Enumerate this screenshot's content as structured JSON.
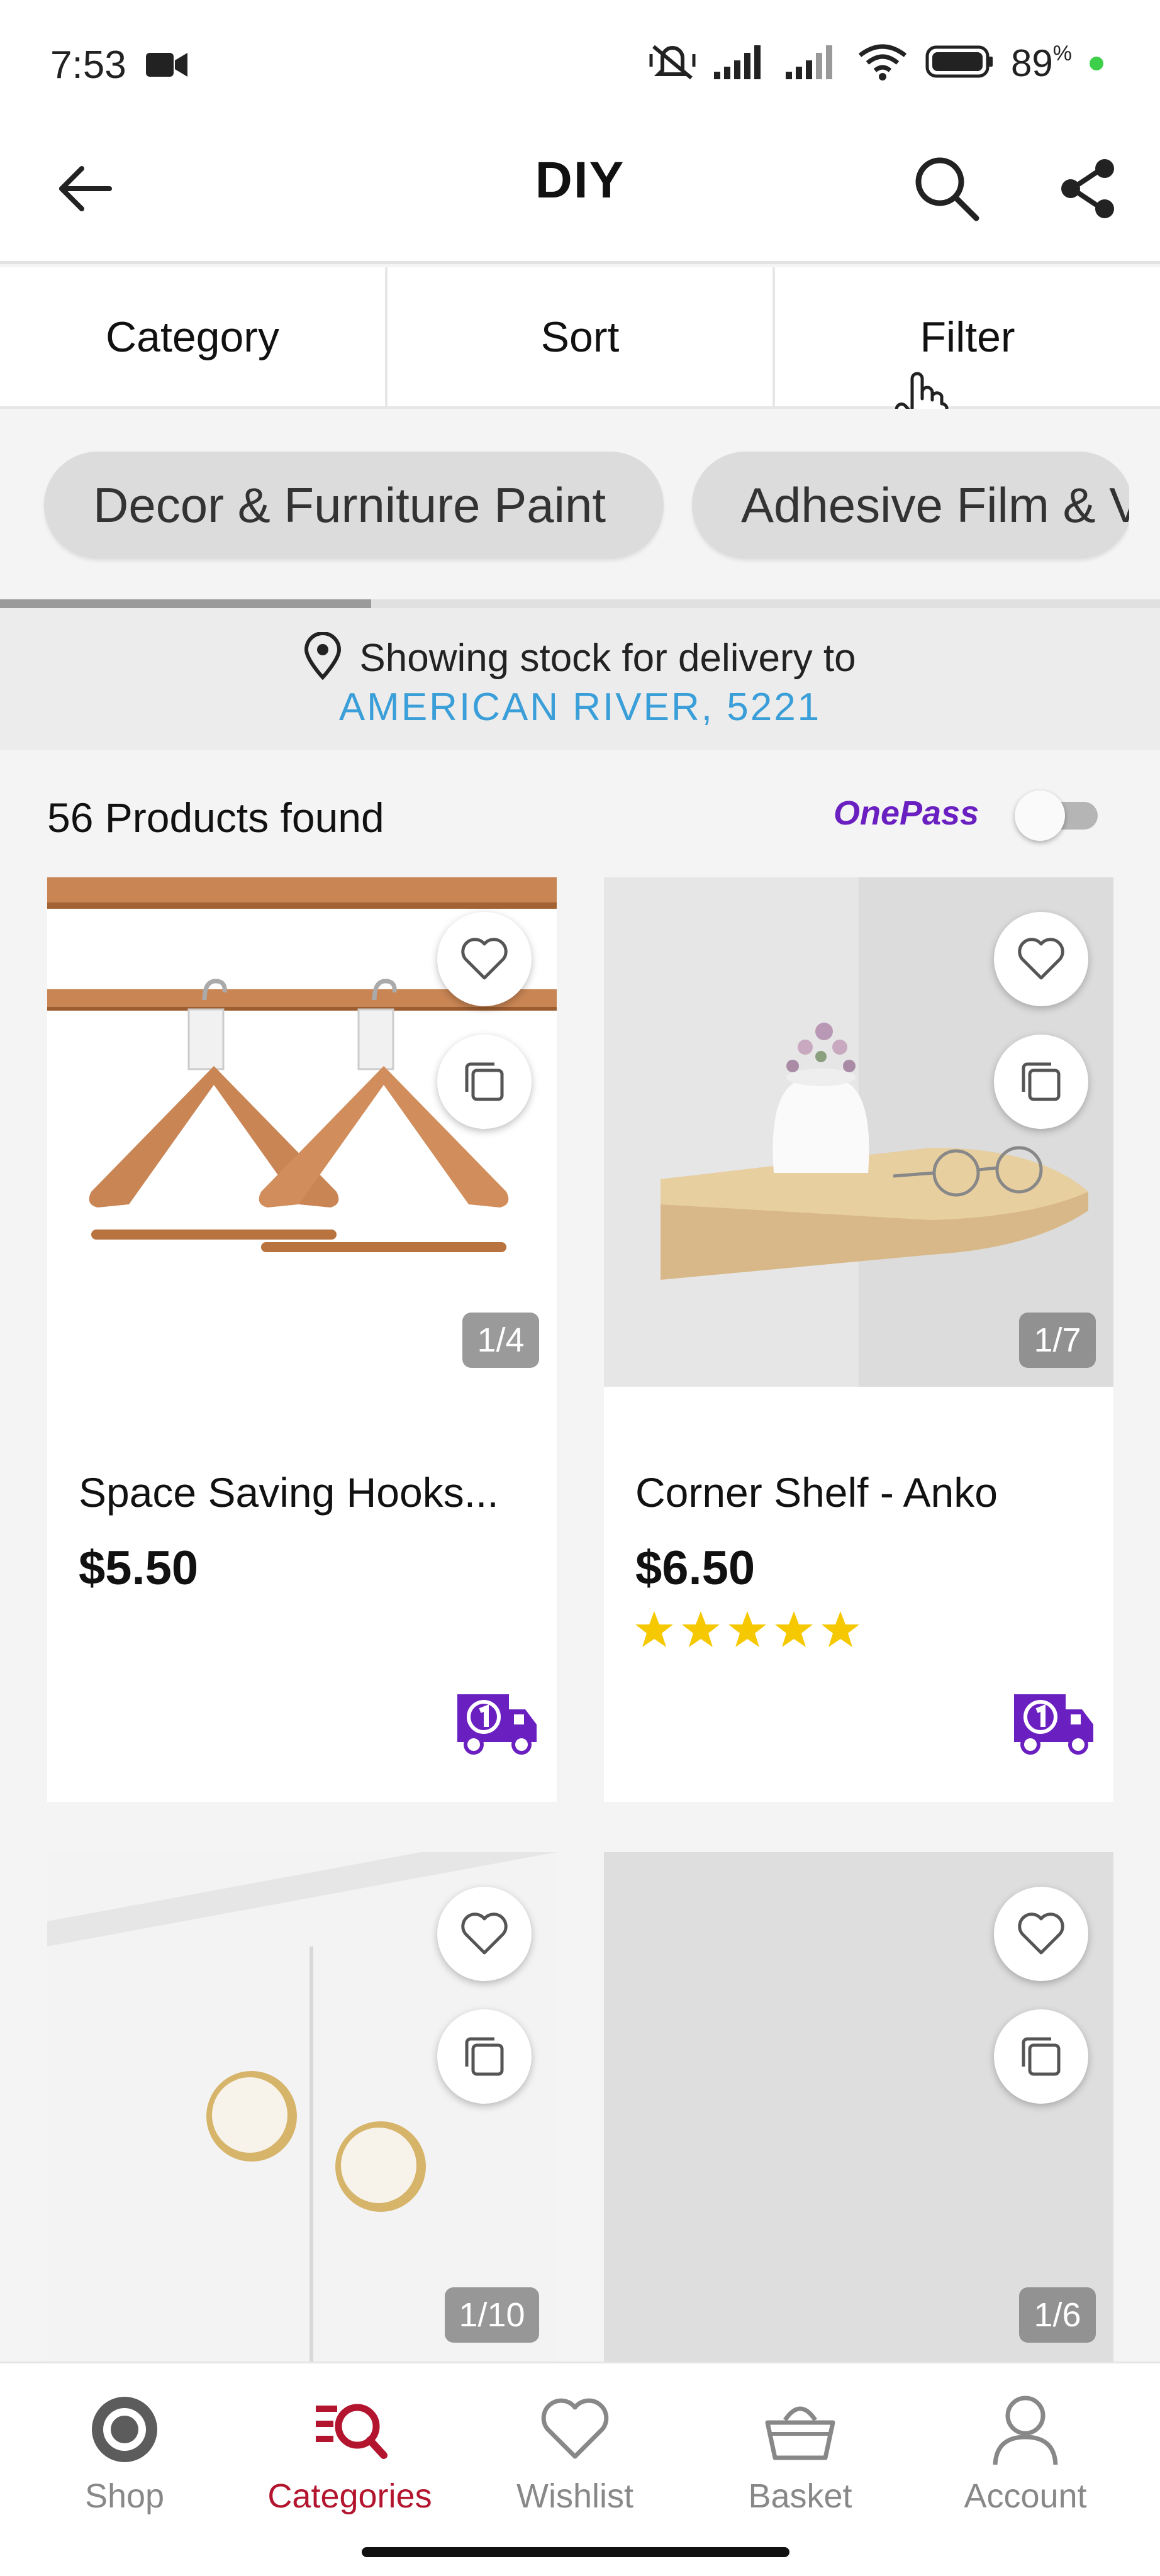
{
  "status_bar": {
    "time": "7:53",
    "battery": "89",
    "battery_unit": "%"
  },
  "header": {
    "title": "DIY"
  },
  "toolbar": {
    "category_label": "Category",
    "sort_label": "Sort",
    "filter_label": "Filter"
  },
  "chips": [
    {
      "label": "Decor & Furniture Paint"
    },
    {
      "label": "Adhesive Film & V"
    }
  ],
  "location": {
    "prefix": "Showing stock for delivery to",
    "place": "AMERICAN RIVER, 5221"
  },
  "results": {
    "count_text": "56 Products found",
    "onepass_label": "OnePass",
    "onepass_toggle_on": false
  },
  "products": [
    {
      "name": "Space Saving Hooks...",
      "price": "$5.50",
      "pager": "1/4",
      "rating": 0
    },
    {
      "name": "Corner Shelf - Anko",
      "price": "$6.50",
      "pager": "1/7",
      "rating": 5
    },
    {
      "name": "",
      "price": "",
      "pager": "1/10",
      "rating": 0
    },
    {
      "name": "",
      "price": "",
      "pager": "1/6",
      "rating": 0
    }
  ],
  "bottom_nav": [
    {
      "label": "Shop",
      "icon": "shop-icon"
    },
    {
      "label": "Categories",
      "icon": "categories-icon",
      "active": true
    },
    {
      "label": "Wishlist",
      "icon": "wishlist-icon"
    },
    {
      "label": "Basket",
      "icon": "basket-icon"
    },
    {
      "label": "Account",
      "icon": "account-icon"
    }
  ],
  "colors": {
    "accent": "#b3152e",
    "link": "#3a9ed8",
    "onepass": "#6a1fc0",
    "star": "#f5c800"
  }
}
